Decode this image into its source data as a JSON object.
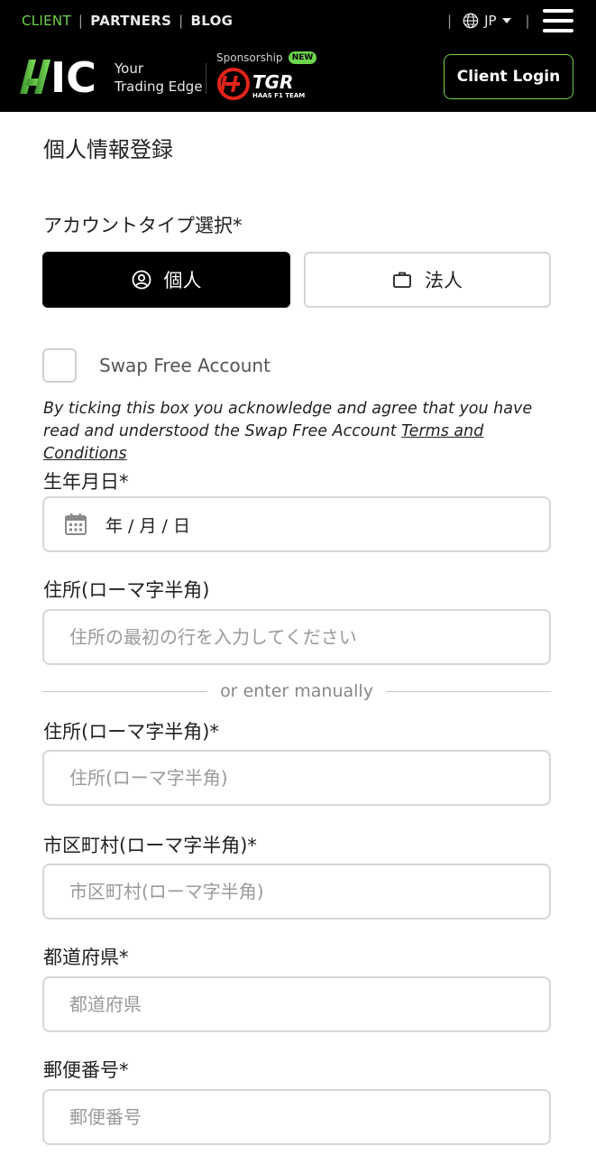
{
  "header": {
    "nav": {
      "client": "CLIENT",
      "partners": "PARTNERS",
      "blog": "BLOG",
      "sep": "|"
    },
    "language": "JP",
    "logo_text": "IC",
    "tagline_line1": "Your",
    "tagline_line2": "Trading Edge",
    "sponsorship_label": "Sponsorship",
    "new_badge": "NEW",
    "sponsor_logo_text": "TGR",
    "sponsor_sub_text": "HAAS F1 TEAM",
    "client_login": "Client Login",
    "colors": {
      "accent": "#6ed34c",
      "background": "#000000",
      "sponsor_red": "#e2231a"
    }
  },
  "form": {
    "title": "個人情報登録",
    "account_type": {
      "label": "アカウントタイプ選択*",
      "options": [
        {
          "label": "個人",
          "icon": "user-circle-icon",
          "selected": true
        },
        {
          "label": "法人",
          "icon": "briefcase-icon",
          "selected": false
        }
      ]
    },
    "swap_free": {
      "label": "Swap Free Account",
      "checked": false,
      "disclaimer": "By ticking this box you acknowledge and agree that you have read and understood the Swap Free Account ",
      "terms_link": "Terms and Conditions"
    },
    "dob": {
      "label": "生年月日*",
      "value": "年 / 月 / 日",
      "icon": "calendar-icon"
    },
    "address_lookup": {
      "label": "住所(ローマ字半角)",
      "placeholder": "住所の最初の行を入力してください"
    },
    "divider": "or enter manually",
    "address": {
      "label": "住所(ローマ字半角)*",
      "placeholder": "住所(ローマ字半角)"
    },
    "city": {
      "label": "市区町村(ローマ字半角)*",
      "placeholder": "市区町村(ローマ字半角)"
    },
    "prefecture": {
      "label": "都道府県*",
      "placeholder": "都道府県"
    },
    "postcode": {
      "label": "郵便番号*",
      "placeholder": "郵便番号"
    }
  }
}
